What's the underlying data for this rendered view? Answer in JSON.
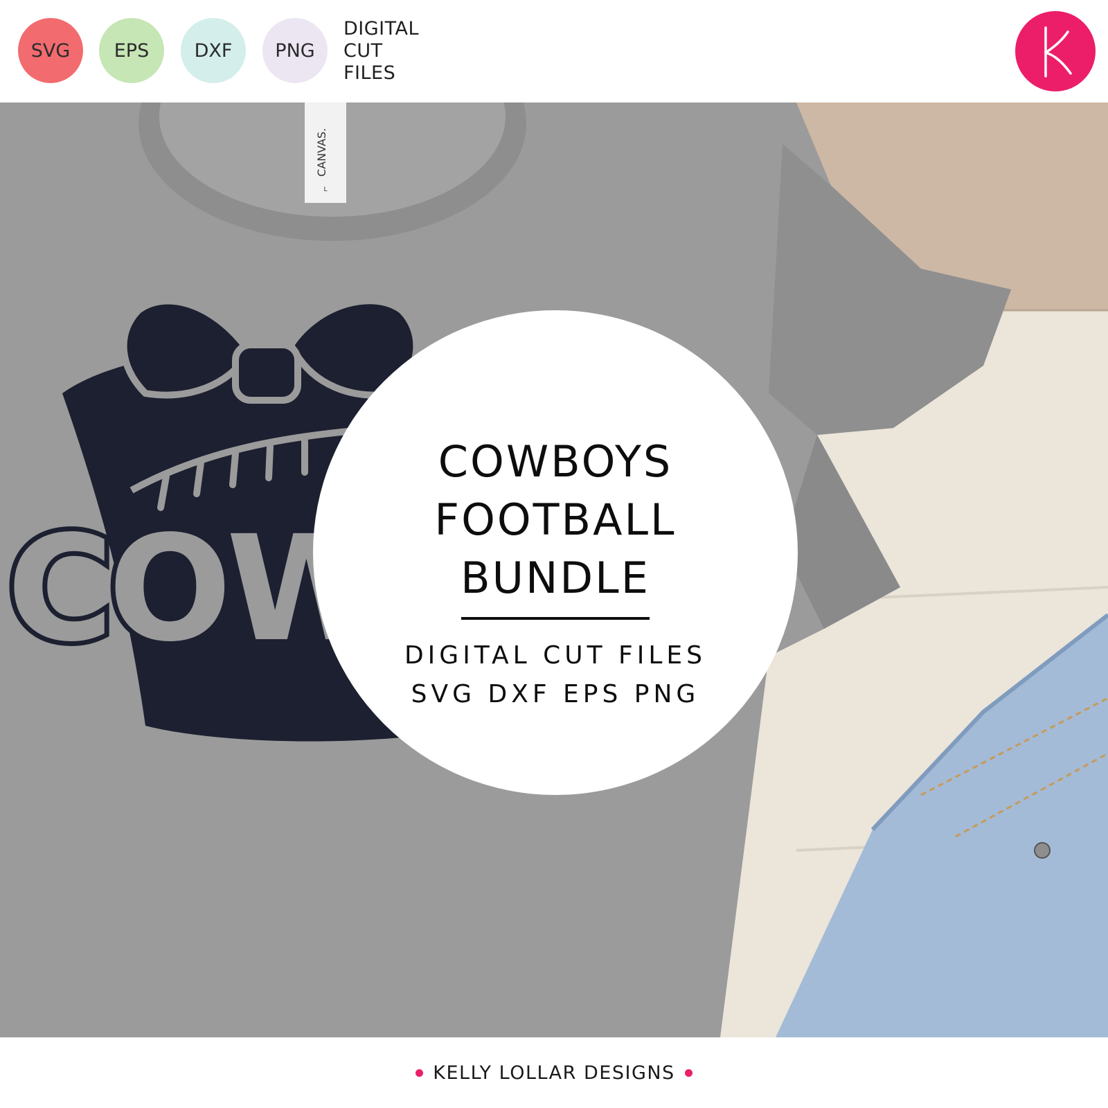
{
  "header": {
    "badges": [
      {
        "label": "SVG",
        "color": "#f26b6f"
      },
      {
        "label": "EPS",
        "color": "#c6e6b5"
      },
      {
        "label": "DXF",
        "color": "#d3eeeb"
      },
      {
        "label": "PNG",
        "color": "#ece6f3"
      }
    ],
    "digital_cut_files": [
      "DIGITAL",
      "CUT",
      "FILES"
    ],
    "logo": {
      "letter": "K",
      "color": "#ec1e6a",
      "icon": "k-logo-icon"
    }
  },
  "title": {
    "lines": [
      "COWBOYS",
      "FOOTBALL",
      "BUNDLE"
    ],
    "subtitle_lines": [
      "DIGITAL CUT FILES",
      "SVG DXF EPS PNG"
    ]
  },
  "photo": {
    "shirt_color": "#9a9a9a",
    "design_color": "#1c2030",
    "wood_color": "#e9e2d6",
    "denim_color": "#a3bbd6",
    "shirt_tag": "CANVAS.",
    "shirt_tag_size": "L",
    "shirt_print_text": "COWB"
  },
  "footer": {
    "text": "KELLY LOLLAR DESIGNS",
    "dot_color": "#ec1e6a"
  }
}
